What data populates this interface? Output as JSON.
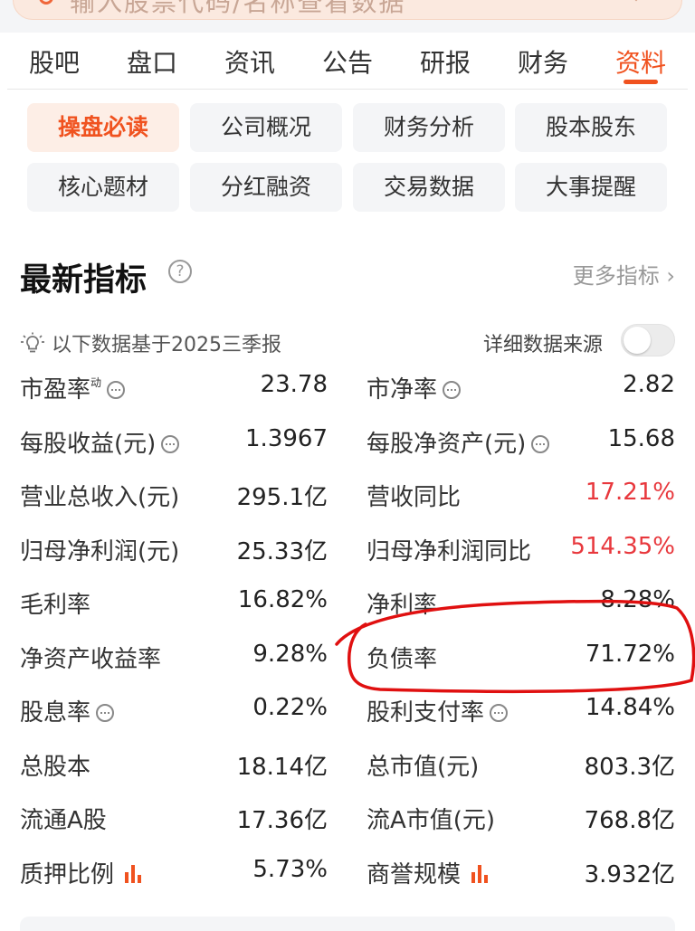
{
  "search": {
    "text": "输入股票代码/名称查看数据",
    "arrow": "↗"
  },
  "tabs": [
    {
      "label": "股吧"
    },
    {
      "label": "盘口"
    },
    {
      "label": "资讯"
    },
    {
      "label": "公告"
    },
    {
      "label": "研报"
    },
    {
      "label": "财务"
    },
    {
      "label": "资料"
    }
  ],
  "active_tab": "资料",
  "subnav": [
    {
      "label": "操盘必读",
      "active": true
    },
    {
      "label": "公司概况"
    },
    {
      "label": "财务分析"
    },
    {
      "label": "股本股东"
    },
    {
      "label": "核心题材"
    },
    {
      "label": "分红融资"
    },
    {
      "label": "交易数据"
    },
    {
      "label": "大事提醒"
    }
  ],
  "section": {
    "title": "最新指标",
    "help_icon": "question-circle-icon",
    "more_label": "更多指标",
    "more_chevron": "›",
    "basis_text": "以下数据基于2025三季报",
    "source_label": "详细数据来源",
    "source_toggle_on": false
  },
  "metrics": [
    {
      "left": {
        "label": "市盈率",
        "sup": "动",
        "info": true,
        "value": "23.78"
      },
      "right": {
        "label": "市净率",
        "info": true,
        "value": "2.82"
      }
    },
    {
      "left": {
        "label": "每股收益(元)",
        "info": true,
        "value": "1.3967"
      },
      "right": {
        "label": "每股净资产(元)",
        "info": true,
        "value": "15.68"
      }
    },
    {
      "left": {
        "label": "营业总收入(元)",
        "value": "295.1亿"
      },
      "right": {
        "label": "营收同比",
        "value": "17.21%",
        "highlight": "red"
      }
    },
    {
      "left": {
        "label": "归母净利润(元)",
        "value": "25.33亿"
      },
      "right": {
        "label": "归母净利润同比",
        "value": "514.35%",
        "highlight": "red"
      }
    },
    {
      "left": {
        "label": "毛利率",
        "value": "16.82%"
      },
      "right": {
        "label": "净利率",
        "value": "8.28%"
      }
    },
    {
      "left": {
        "label": "净资产收益率",
        "value": "9.28%"
      },
      "right": {
        "label": "负债率",
        "value": "71.72%"
      }
    },
    {
      "left": {
        "label": "股息率",
        "info": true,
        "value": "0.22%"
      },
      "right": {
        "label": "股利支付率",
        "info": true,
        "value": "14.84%"
      }
    },
    {
      "left": {
        "label": "总股本",
        "value": "18.14亿"
      },
      "right": {
        "label": "总市值(元)",
        "value": "803.3亿"
      }
    },
    {
      "left": {
        "label": "流通A股",
        "value": "17.36亿"
      },
      "right": {
        "label": "流A市值(元)",
        "value": "768.8亿"
      }
    },
    {
      "left": {
        "label": "质押比例",
        "chart_icon": true,
        "value": "5.73%"
      },
      "right": {
        "label": "商誉规模",
        "chart_icon": true,
        "value": "3.932亿"
      }
    }
  ],
  "colors": {
    "accent": "#f0521f",
    "positive_red": "#e8383d",
    "annotation_red": "#e01010"
  }
}
